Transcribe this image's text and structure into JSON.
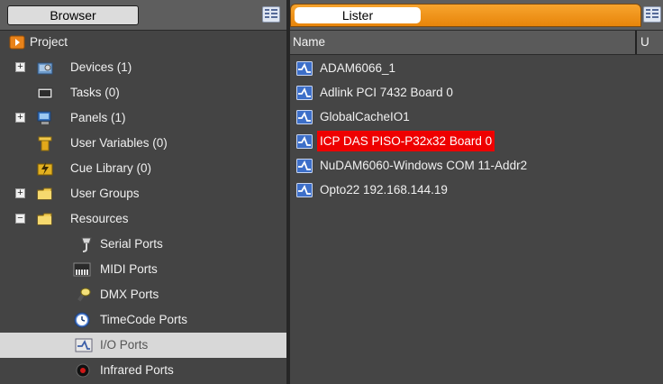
{
  "browser": {
    "tab_label": "Browser",
    "tree": [
      {
        "label": "Project",
        "icon": "project-icon",
        "expander": null
      },
      {
        "label": "Devices (1)",
        "icon": "devices-icon",
        "expander": "+"
      },
      {
        "label": "Tasks (0)",
        "icon": "tasks-icon",
        "expander": null
      },
      {
        "label": "Panels (1)",
        "icon": "panels-icon",
        "expander": "+"
      },
      {
        "label": "User Variables (0)",
        "icon": "user-variables-icon",
        "expander": null
      },
      {
        "label": "Cue Library (0)",
        "icon": "cue-library-icon",
        "expander": null
      },
      {
        "label": "User Groups",
        "icon": "folder-icon",
        "expander": "+"
      },
      {
        "label": "Resources",
        "icon": "folder-icon",
        "expander": "−"
      },
      {
        "label": "Serial Ports",
        "icon": "serial-port-icon",
        "expander": null
      },
      {
        "label": "MIDI Ports",
        "icon": "midi-port-icon",
        "expander": null
      },
      {
        "label": "DMX Ports",
        "icon": "dmx-port-icon",
        "expander": null
      },
      {
        "label": "TimeCode Ports",
        "icon": "timecode-clock-icon",
        "expander": null
      },
      {
        "label": "I/O Ports",
        "icon": "io-port-icon",
        "expander": null,
        "selected": true
      },
      {
        "label": "Infrared Ports",
        "icon": "infrared-icon",
        "expander": null
      }
    ]
  },
  "lister": {
    "tab_label": "Lister",
    "columns": {
      "name": "Name",
      "u": "U"
    },
    "items": [
      {
        "label": "ADAM6066_1"
      },
      {
        "label": "Adlink PCI 7432 Board 0"
      },
      {
        "label": "GlobalCacheIO1"
      },
      {
        "label": "ICP DAS PISO-P32x32 Board 0",
        "highlighted": true
      },
      {
        "label": "NuDAM6060-Windows COM 11-Addr2"
      },
      {
        "label": "Opto22 192.168.144.19"
      }
    ]
  },
  "colors": {
    "panel_bg": "#444444",
    "header_bg": "#5e5e5e",
    "accent_orange": "#f0961e",
    "highlight_red": "#ee0000",
    "selected_row": "#d8d8d8"
  }
}
